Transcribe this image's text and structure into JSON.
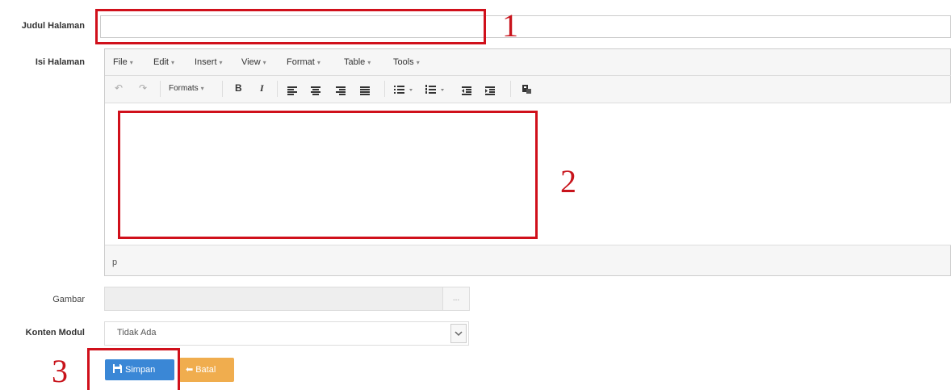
{
  "form": {
    "judul_label": "Judul Halaman",
    "judul_value": "",
    "isi_label": "Isi Halaman",
    "gambar_label": "Gambar",
    "gambar_browse": "...",
    "konten_label": "Konten Modul",
    "konten_selected": "Tidak Ada"
  },
  "editor": {
    "menu": [
      "File",
      "Edit",
      "Insert",
      "View",
      "Format",
      "Table",
      "Tools"
    ],
    "formats_label": "Formats",
    "bold_label": "B",
    "italic_label": "I",
    "statusbar_path": "p",
    "content": ""
  },
  "buttons": {
    "save_label": "Simpan",
    "cancel_label": "Batal"
  },
  "annotations": {
    "n1": "1",
    "n2": "2",
    "n3": "3",
    "color": "#d0101b"
  },
  "colors": {
    "primary": "#3a87d6",
    "warning": "#f0ad4e"
  }
}
